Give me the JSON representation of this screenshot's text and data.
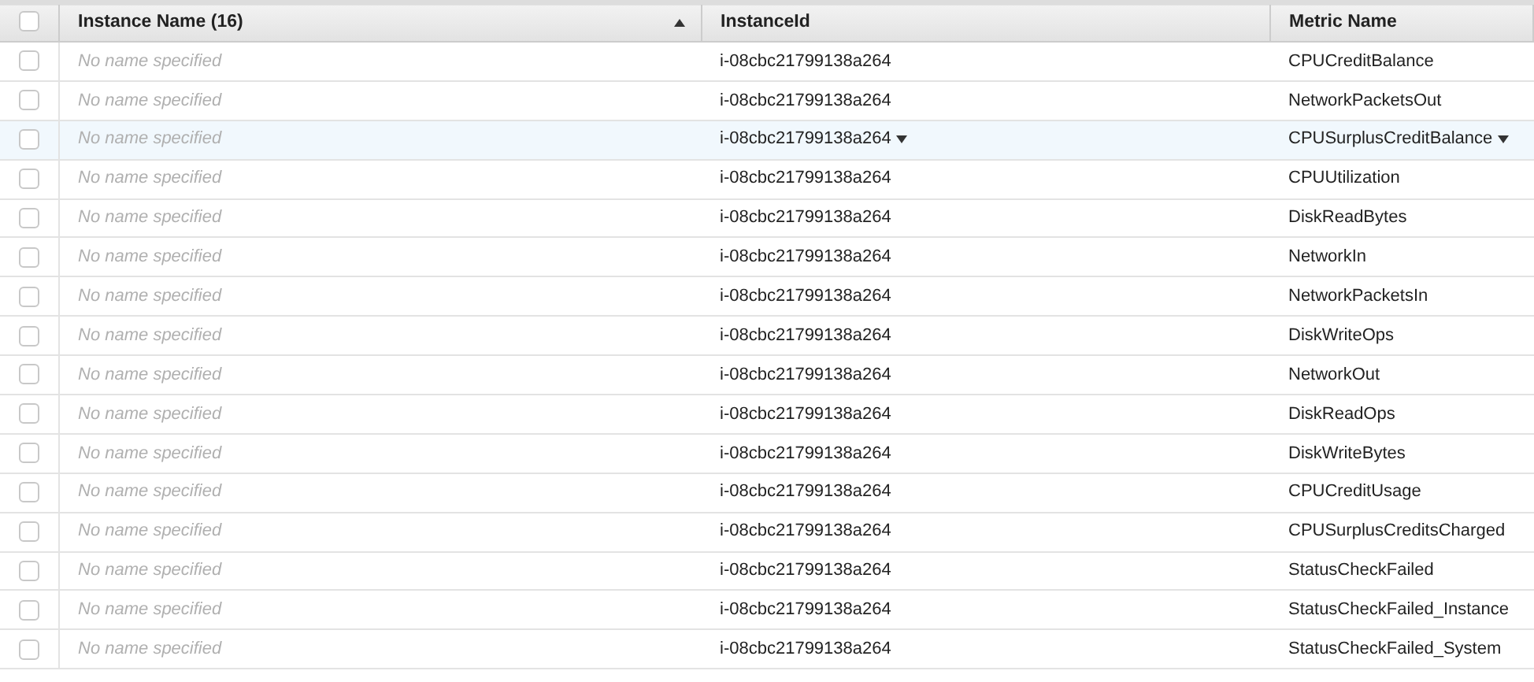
{
  "table": {
    "select_all_checked": false,
    "columns": [
      {
        "label": "Instance Name (16)",
        "sorted": true
      },
      {
        "label": "InstanceId",
        "sorted": false
      },
      {
        "label": "Metric Name",
        "sorted": false
      }
    ],
    "rows": [
      {
        "checked": false,
        "hovered": false,
        "name": "No name specified",
        "instance_id": "i-08cbc21799138a264",
        "metric": "CPUCreditBalance"
      },
      {
        "checked": false,
        "hovered": false,
        "name": "No name specified",
        "instance_id": "i-08cbc21799138a264",
        "metric": "NetworkPacketsOut"
      },
      {
        "checked": false,
        "hovered": true,
        "name": "No name specified",
        "instance_id": "i-08cbc21799138a264",
        "metric": "CPUSurplusCreditBalance"
      },
      {
        "checked": false,
        "hovered": false,
        "name": "No name specified",
        "instance_id": "i-08cbc21799138a264",
        "metric": "CPUUtilization"
      },
      {
        "checked": false,
        "hovered": false,
        "name": "No name specified",
        "instance_id": "i-08cbc21799138a264",
        "metric": "DiskReadBytes"
      },
      {
        "checked": false,
        "hovered": false,
        "name": "No name specified",
        "instance_id": "i-08cbc21799138a264",
        "metric": "NetworkIn"
      },
      {
        "checked": false,
        "hovered": false,
        "name": "No name specified",
        "instance_id": "i-08cbc21799138a264",
        "metric": "NetworkPacketsIn"
      },
      {
        "checked": false,
        "hovered": false,
        "name": "No name specified",
        "instance_id": "i-08cbc21799138a264",
        "metric": "DiskWriteOps"
      },
      {
        "checked": false,
        "hovered": false,
        "name": "No name specified",
        "instance_id": "i-08cbc21799138a264",
        "metric": "NetworkOut"
      },
      {
        "checked": false,
        "hovered": false,
        "name": "No name specified",
        "instance_id": "i-08cbc21799138a264",
        "metric": "DiskReadOps"
      },
      {
        "checked": false,
        "hovered": false,
        "name": "No name specified",
        "instance_id": "i-08cbc21799138a264",
        "metric": "DiskWriteBytes"
      },
      {
        "checked": false,
        "hovered": false,
        "name": "No name specified",
        "instance_id": "i-08cbc21799138a264",
        "metric": "CPUCreditUsage"
      },
      {
        "checked": false,
        "hovered": false,
        "name": "No name specified",
        "instance_id": "i-08cbc21799138a264",
        "metric": "CPUSurplusCreditsCharged"
      },
      {
        "checked": false,
        "hovered": false,
        "name": "No name specified",
        "instance_id": "i-08cbc21799138a264",
        "metric": "StatusCheckFailed"
      },
      {
        "checked": false,
        "hovered": false,
        "name": "No name specified",
        "instance_id": "i-08cbc21799138a264",
        "metric": "StatusCheckFailed_Instance"
      },
      {
        "checked": false,
        "hovered": false,
        "name": "No name specified",
        "instance_id": "i-08cbc21799138a264",
        "metric": "StatusCheckFailed_System"
      }
    ]
  }
}
